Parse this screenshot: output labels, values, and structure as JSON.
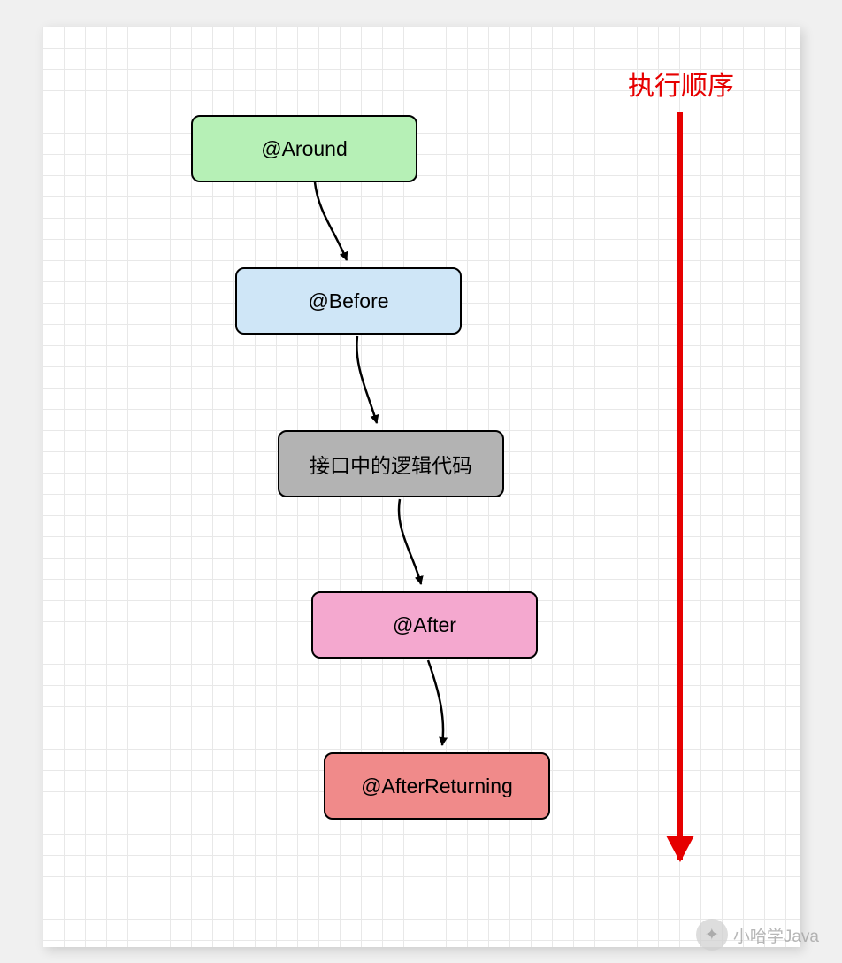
{
  "flow_label": "执行顺序",
  "nodes": [
    {
      "label": "@Around",
      "fill": "#b6f0b6"
    },
    {
      "label": "@Before",
      "fill": "#cfe6f7"
    },
    {
      "label": "接口中的逻辑代码",
      "fill": "#b3b3b3"
    },
    {
      "label": "@After",
      "fill": "#f4a8cf"
    },
    {
      "label": "@AfterReturning",
      "fill": "#f08a8a"
    }
  ],
  "watermark": "小哈学Java",
  "colors": {
    "arrow": "#e60000",
    "connector": "#000000"
  }
}
